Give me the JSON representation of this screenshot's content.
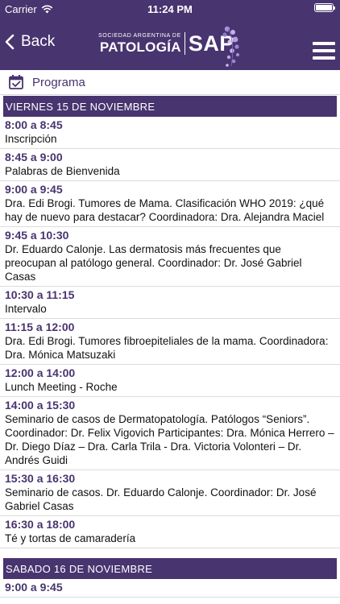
{
  "status": {
    "carrier": "Carrier",
    "time": "11:24 PM",
    "battery_level": 1.0
  },
  "nav": {
    "back_label": "Back",
    "logo_small": "SOCIEDAD ARGENTINA DE",
    "logo_big": "PATOLOGÍA",
    "logo_sap": "SAP"
  },
  "section": {
    "title": "Programa"
  },
  "days": [
    {
      "header": "VIERNES 15 DE NOVIEMBRE",
      "entries": [
        {
          "time": "8:00 a 8:45",
          "desc": "Inscripción"
        },
        {
          "time": "8:45 a 9:00",
          "desc": "Palabras de Bienvenida"
        },
        {
          "time": "9:00 a 9:45",
          "desc": "Dra. Edi Brogi. Tumores de Mama. Clasificación WHO 2019: ¿qué hay de nuevo para destacar? Coordinadora: Dra. Alejandra Maciel"
        },
        {
          "time": "9:45 a 10:30",
          "desc": "Dr. Eduardo Calonje. Las dermatosis más frecuentes que preocupan al patólogo general. Coordinador: Dr. José Gabriel Casas"
        },
        {
          "time": "10:30 a 11:15",
          "desc": "Intervalo"
        },
        {
          "time": "11:15 a 12:00",
          "desc": "Dra. Edi Brogi. Tumores fibroepiteliales de la mama. Coordinadora: Dra. Mónica Matsuzaki"
        },
        {
          "time": "12:00 a 14:00",
          "desc": "Lunch Meeting - Roche"
        },
        {
          "time": "14:00 a 15:30",
          "desc": "Seminario de casos de Dermatopatología. Patólogos “Seniors”. Coordinador: Dr. Felix Vigovich  Participantes:  Dra. Mónica Herrero – Dr. Diego Díaz – Dra. Carla Trila - Dra. Victoria Volonteri – Dr. Andrés Guidi"
        },
        {
          "time": "15:30 a 16:30",
          "desc": "Seminario de casos. Dr. Eduardo Calonje. Coordinador: Dr. José Gabriel Casas"
        },
        {
          "time": "16:30 a 18:00",
          "desc": "Té y tortas de camaradería"
        }
      ]
    },
    {
      "header": "SABADO 16 DE NOVIEMBRE",
      "entries": [
        {
          "time": "9:00 a 9:45",
          "desc": ""
        }
      ]
    }
  ]
}
